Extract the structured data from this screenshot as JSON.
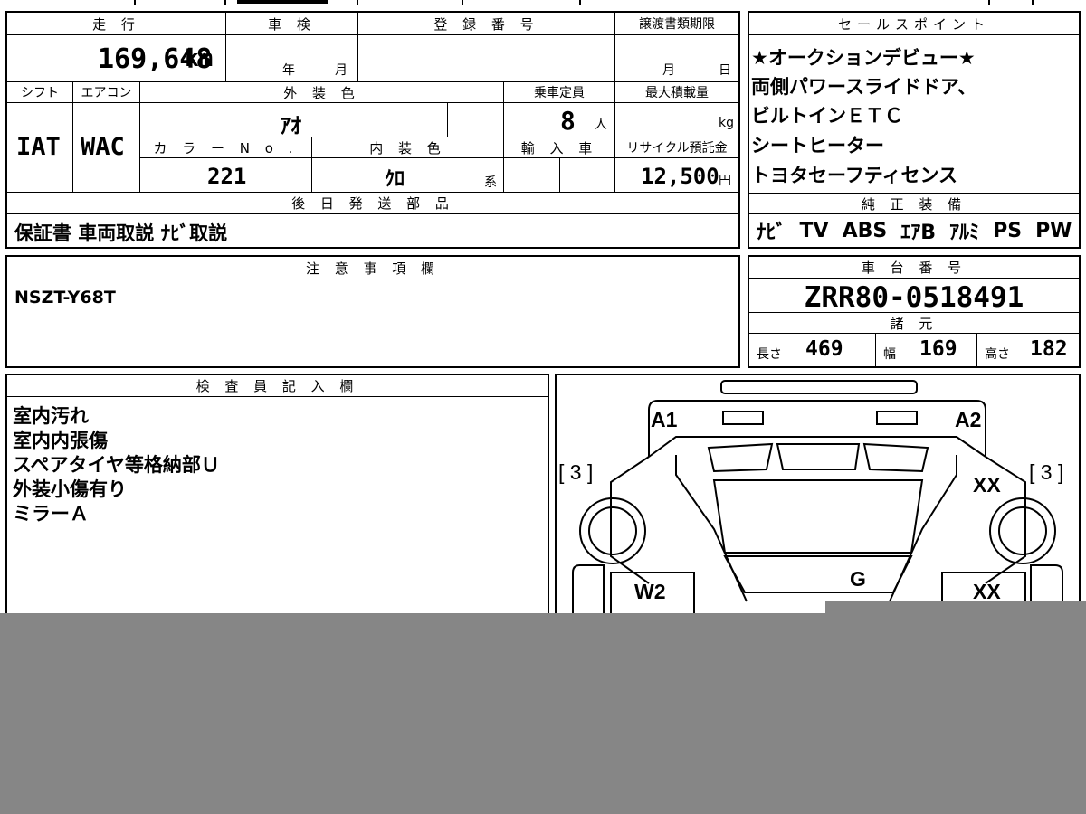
{
  "top_table": {
    "headers": {
      "mileage": "走 行",
      "inspection": "車 検",
      "registration": "登 録 番 号",
      "transfer_deadline": "譲渡書類期限",
      "shift": "シフト",
      "aircon": "エアコン",
      "exterior_color": "外 装 色",
      "capacity": "乗車定員",
      "max_load": "最大積載量",
      "color_no": "カ ラ ー N o .",
      "interior_color": "内 装 色",
      "import": "輸 入 車",
      "recycle": "リサイクル預託金",
      "later_parts": "後 日 発 送 部 品"
    },
    "mileage": "169,648",
    "mileage_unit": "km",
    "inspection_year_unit": "年",
    "inspection_month_unit": "月",
    "registration_value": "",
    "transfer_month_unit": "月",
    "transfer_day_unit": "日",
    "shift": "IAT",
    "aircon": "WAC",
    "exterior_color": "ｱｵ",
    "capacity": "8",
    "capacity_unit": "人",
    "max_load_unit": "kg",
    "color_no": "221",
    "interior_color": "ｸﾛ",
    "interior_suffix": "系",
    "recycle_fee": "12,500",
    "recycle_unit": "円",
    "later_parts": "保証書 車両取説 ﾅﾋﾞ取説"
  },
  "sales_points": {
    "header": "セールスポイント",
    "lines": [
      "★オークションデビュー★",
      "両側パワースライドドア、",
      "ビルトインＥＴＣ",
      "シートヒーター",
      "トヨタセーフティセンス"
    ]
  },
  "genuine_equipment": {
    "header": "純 正 装 備",
    "items": [
      "ﾅﾋﾞ",
      "TV",
      "ABS",
      "ｴｱB",
      "ｱﾙﾐ",
      "PS",
      "PW"
    ]
  },
  "notes": {
    "header": "注 意 事 項 欄",
    "text": "NSZT-Y68T"
  },
  "chassis": {
    "header": "車 台 番 号",
    "number": "ZRR80-0518491"
  },
  "specs": {
    "header": "諸 元",
    "length_label": "長さ",
    "length": "469",
    "width_label": "幅",
    "width": "169",
    "height_label": "高さ",
    "height": "182"
  },
  "inspector": {
    "header": "検 査 員 記 入 欄",
    "lines": [
      "室内汚れ",
      "室内内張傷",
      "スペアタイヤ等格納部Ｕ",
      "外装小傷有り",
      "ミラーＡ"
    ]
  },
  "diagram": {
    "labels": {
      "a1": "A1",
      "a2": "A2",
      "left_tire": "[ 3 ]",
      "right_tire": "[ 3 ]",
      "xx_top": "XX",
      "xx_mid": "XX",
      "w2": "W2",
      "g": "G"
    }
  }
}
